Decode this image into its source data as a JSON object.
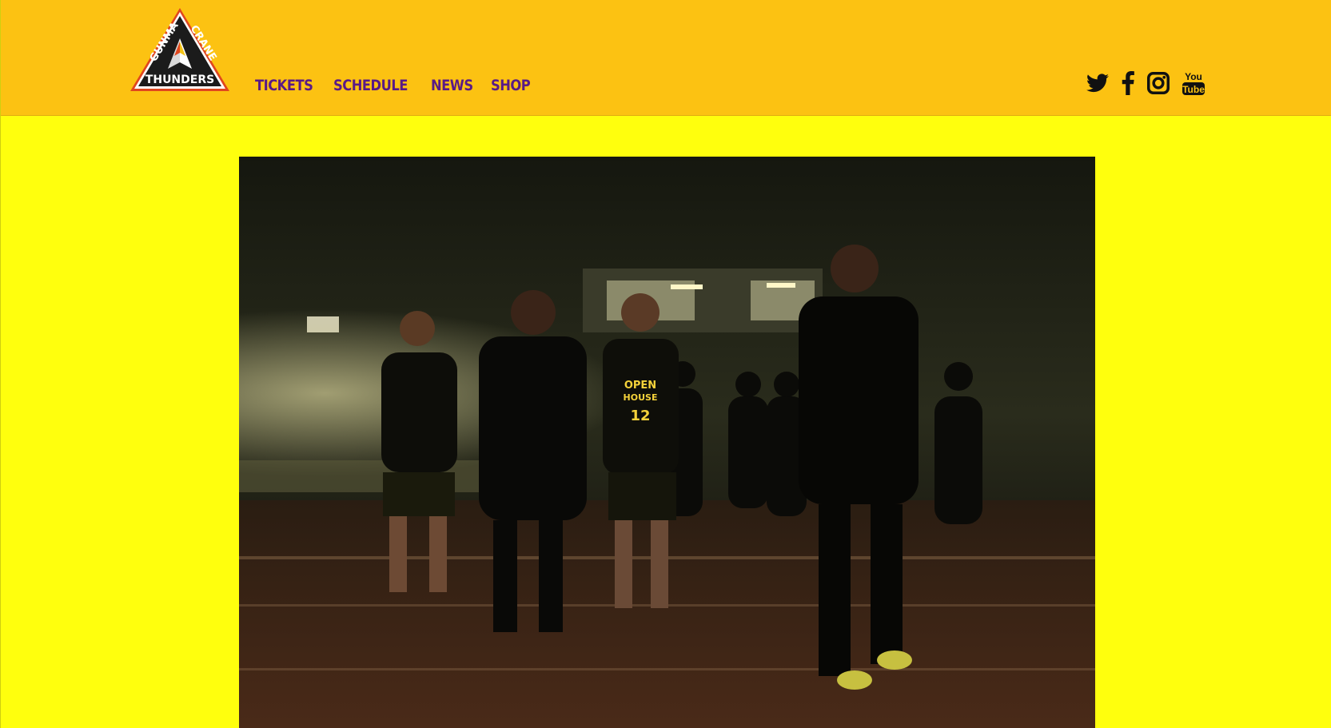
{
  "brand": {
    "logo_lines": [
      "GUNMA",
      "CRANE",
      "THUNDERS"
    ],
    "colors": {
      "header_bg": "#FCC212",
      "page_bg": "#FFFF0D",
      "nav_text": "#5A1A86",
      "icon": "#111111"
    }
  },
  "nav": {
    "items": [
      {
        "label": "TICKETS"
      },
      {
        "label": "SCHEDULE"
      },
      {
        "label": "NEWS"
      },
      {
        "label": "SHOP"
      }
    ]
  },
  "social": {
    "icons": [
      "twitter-icon",
      "facebook-icon",
      "instagram-icon",
      "youtube-icon"
    ],
    "youtube_text": [
      "You",
      "Tube"
    ]
  },
  "hero": {
    "description_icon": "team-photo-image",
    "jersey_texts": [
      "OPEN",
      "HOUSE",
      "12"
    ]
  }
}
